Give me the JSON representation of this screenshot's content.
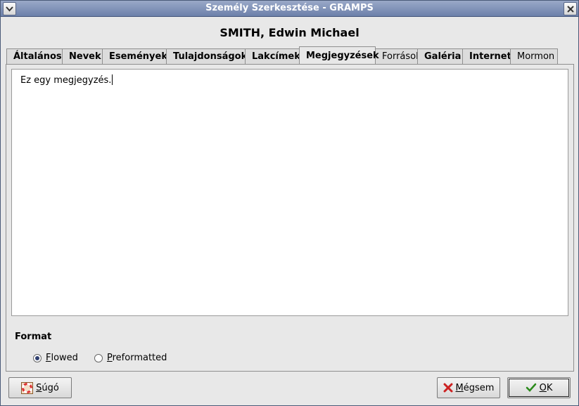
{
  "window": {
    "title": "Személy Szerkesztése - GRAMPS",
    "menu_icon": "chevron-down-icon",
    "close_icon": "close-icon"
  },
  "person": {
    "name": "SMITH, Edwin Michael"
  },
  "tabs": [
    {
      "label": "Általános"
    },
    {
      "label": "Nevek"
    },
    {
      "label": "Események"
    },
    {
      "label": "Tulajdonságok"
    },
    {
      "label": "Lakcímek"
    },
    {
      "label": "Megjegyzések",
      "active": true
    },
    {
      "label": "Források"
    },
    {
      "label": "Galéria"
    },
    {
      "label": "Internet"
    },
    {
      "label": "Mormon"
    }
  ],
  "note": {
    "text": "Ez egy megjegyzés."
  },
  "format": {
    "label": "Format",
    "options": [
      {
        "first": "F",
        "rest": "lowed",
        "selected": true
      },
      {
        "first": "P",
        "rest": "reformatted",
        "selected": false
      }
    ]
  },
  "buttons": {
    "help": {
      "first": "S",
      "rest": "úgó",
      "icon": "lifebuoy-icon"
    },
    "cancel": {
      "first": "M",
      "rest": "égsem",
      "icon": "cancel-x-icon"
    },
    "ok": {
      "first": "O",
      "rest": "K",
      "icon": "checkmark-icon"
    }
  },
  "colors": {
    "titlebar": "#7b8db5",
    "selection_dot": "#2f3f6f",
    "cancel_red": "#cc2222",
    "ok_green": "#2a8a1a"
  }
}
